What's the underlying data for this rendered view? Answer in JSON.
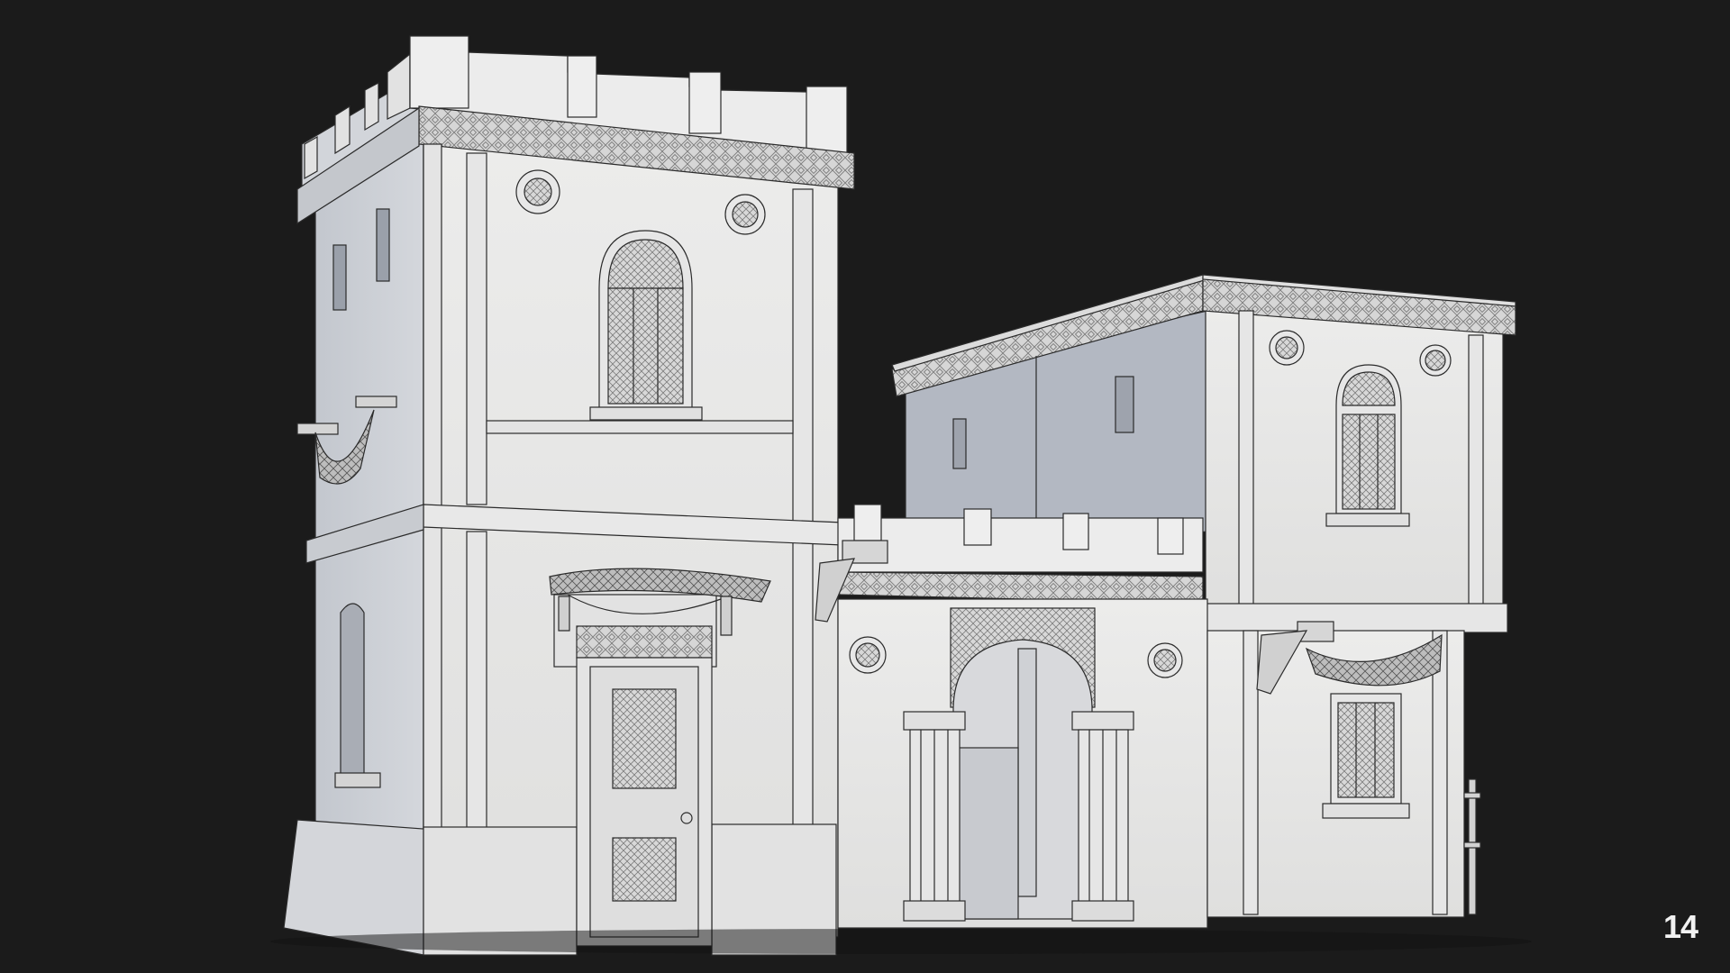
{
  "scene": {
    "subject": "clay-render-with-wireframe",
    "colors": {
      "background": "#1b1b1b",
      "wall_light": "#ebebea",
      "wall_mid": "#dcdcdb",
      "wall_shadow": "#b9bcc2",
      "wall_blue_shadow": "#aeb3bd",
      "line": "#2b2b2b",
      "ornament": "#9c9c9c"
    }
  },
  "page_number": "14"
}
